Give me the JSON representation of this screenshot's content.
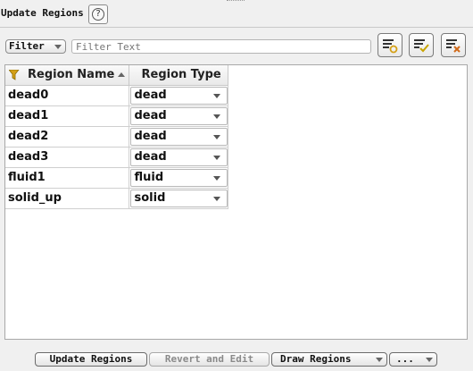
{
  "header": {
    "title": "Update Regions",
    "help_glyph": "?"
  },
  "filter": {
    "dropdown_label": "Filter",
    "search_placeholder": "Filter Text",
    "search_value": ""
  },
  "toolbar": {
    "icons": [
      "filter-add-icon",
      "filter-apply-icon",
      "filter-clear-icon"
    ]
  },
  "table": {
    "columns": [
      "Region Name",
      "Region Type"
    ],
    "sort_column": "Region Name",
    "sort_direction": "ascending",
    "rows": [
      {
        "name": "dead0",
        "type": "dead"
      },
      {
        "name": "dead1",
        "type": "dead"
      },
      {
        "name": "dead2",
        "type": "dead"
      },
      {
        "name": "dead3",
        "type": "dead"
      },
      {
        "name": "fluid1",
        "type": "fluid"
      },
      {
        "name": "solid_up",
        "type": "solid"
      }
    ]
  },
  "actions": {
    "update": "Update Regions",
    "revert": "Revert and Edit",
    "draw": "Draw Regions",
    "more": "..."
  },
  "colors": {
    "filter_icon": "#d4a017",
    "check_icon": "#c9a400",
    "clear_icon": "#d06a1a"
  }
}
